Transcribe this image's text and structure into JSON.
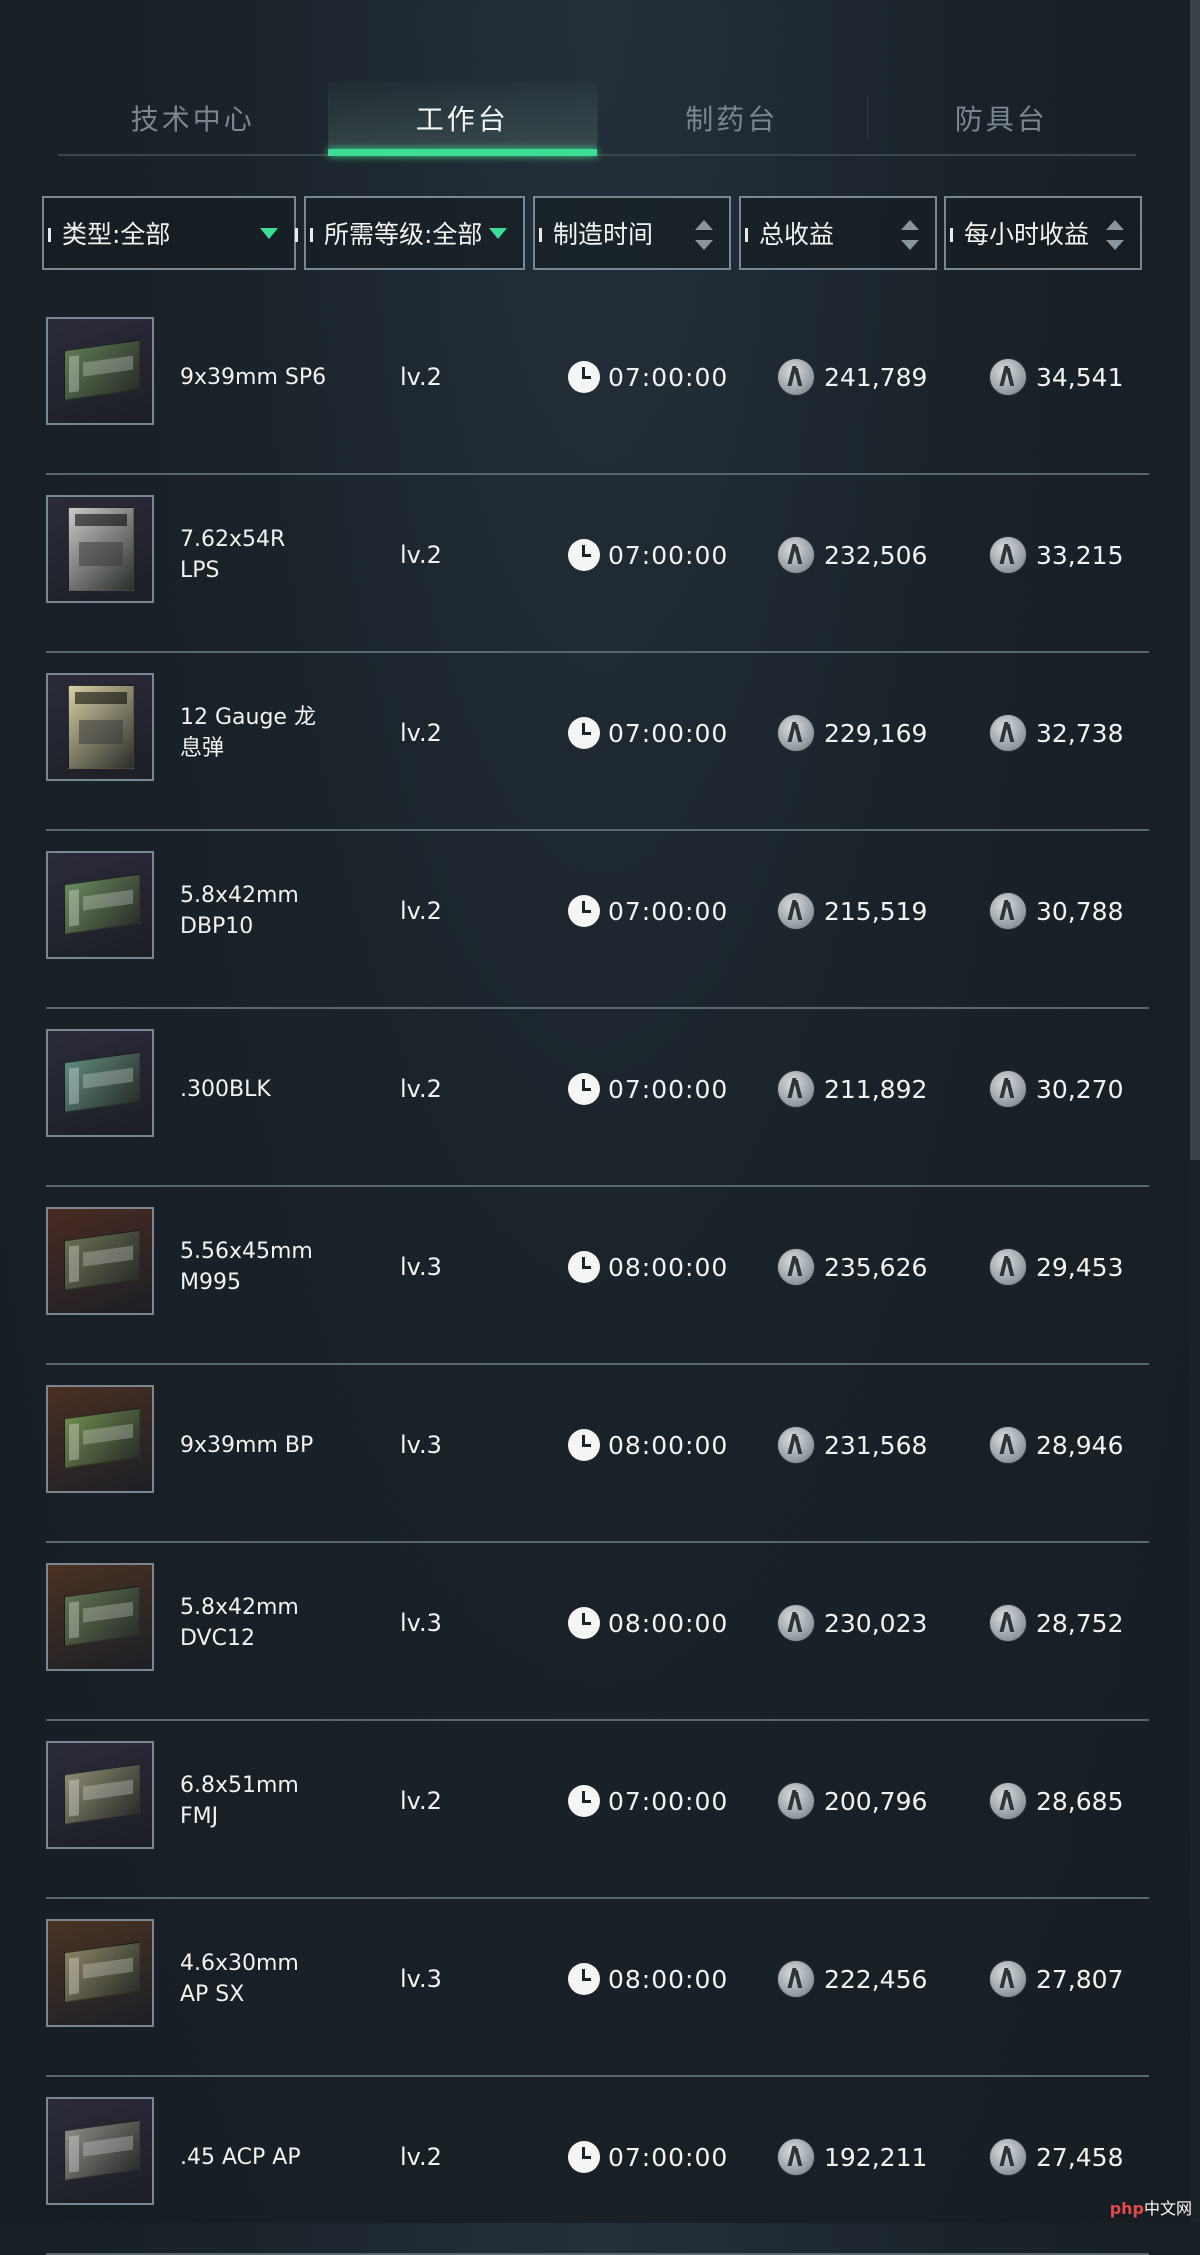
{
  "tabs": [
    {
      "label": "技术中心",
      "active": false
    },
    {
      "label": "工作台",
      "active": true
    },
    {
      "label": "制药台",
      "active": false
    },
    {
      "label": "防具台",
      "active": false
    }
  ],
  "filters": {
    "type": "类型:全部",
    "level": "所需等级:全部",
    "time": "制造时间",
    "total": "总收益",
    "hourly": "每小时收益"
  },
  "colors": {
    "accent": "#3fdc95",
    "background": "#1a2229",
    "border": "#7a8690"
  },
  "rows": [
    {
      "name": "9x39mm SP6",
      "level": "lv.2",
      "time": "07:00:00",
      "total": "241,789",
      "hourly": "34,541",
      "thumb_bg": "#2b2a3a",
      "box_color": "#5e7a52",
      "tall": false
    },
    {
      "name": "7.62x54R LPS",
      "level": "lv.2",
      "time": "07:00:00",
      "total": "232,506",
      "hourly": "33,215",
      "thumb_bg": "#2b2a3a",
      "box_color": "#c9cbc7",
      "tall": true
    },
    {
      "name": "12 Gauge 龙息弹",
      "level": "lv.2",
      "time": "07:00:00",
      "total": "229,169",
      "hourly": "32,738",
      "thumb_bg": "#2b2a3a",
      "box_color": "#d8cfa6",
      "tall": true
    },
    {
      "name": "5.8x42mm DBP10",
      "level": "lv.2",
      "time": "07:00:00",
      "total": "215,519",
      "hourly": "30,788",
      "thumb_bg": "#2b2a3a",
      "box_color": "#6a8a5c",
      "tall": false
    },
    {
      "name": ".300BLK",
      "level": "lv.2",
      "time": "07:00:00",
      "total": "211,892",
      "hourly": "30,270",
      "thumb_bg": "#2b2a3a",
      "box_color": "#5e8a80",
      "tall": false
    },
    {
      "name": "5.56x45mm M995",
      "level": "lv.3",
      "time": "08:00:00",
      "total": "235,626",
      "hourly": "29,453",
      "thumb_bg": "#4a2a22",
      "box_color": "#6a6e52",
      "tall": false
    },
    {
      "name": "9x39mm BP",
      "level": "lv.3",
      "time": "08:00:00",
      "total": "231,568",
      "hourly": "28,946",
      "thumb_bg": "#4a2f22",
      "box_color": "#6f8a4e",
      "tall": false
    },
    {
      "name": "5.8x42mm DVC12",
      "level": "lv.3",
      "time": "08:00:00",
      "total": "230,023",
      "hourly": "28,752",
      "thumb_bg": "#4a3122",
      "box_color": "#5f7250",
      "tall": false
    },
    {
      "name": "6.8x51mm FMJ",
      "level": "lv.2",
      "time": "07:00:00",
      "total": "200,796",
      "hourly": "28,685",
      "thumb_bg": "#2b2a3a",
      "box_color": "#8d8a72",
      "tall": false
    },
    {
      "name": "4.6x30mm AP SX",
      "level": "lv.3",
      "time": "08:00:00",
      "total": "222,456",
      "hourly": "27,807",
      "thumb_bg": "#4a3324",
      "box_color": "#8a8262",
      "tall": false
    },
    {
      "name": ".45 ACP AP",
      "level": "lv.2",
      "time": "07:00:00",
      "total": "192,211",
      "hourly": "27,458",
      "thumb_bg": "#2b2a3a",
      "box_color": "#8a8a86",
      "tall": false
    }
  ],
  "watermark": {
    "brand": "php",
    "site": "中文网"
  }
}
